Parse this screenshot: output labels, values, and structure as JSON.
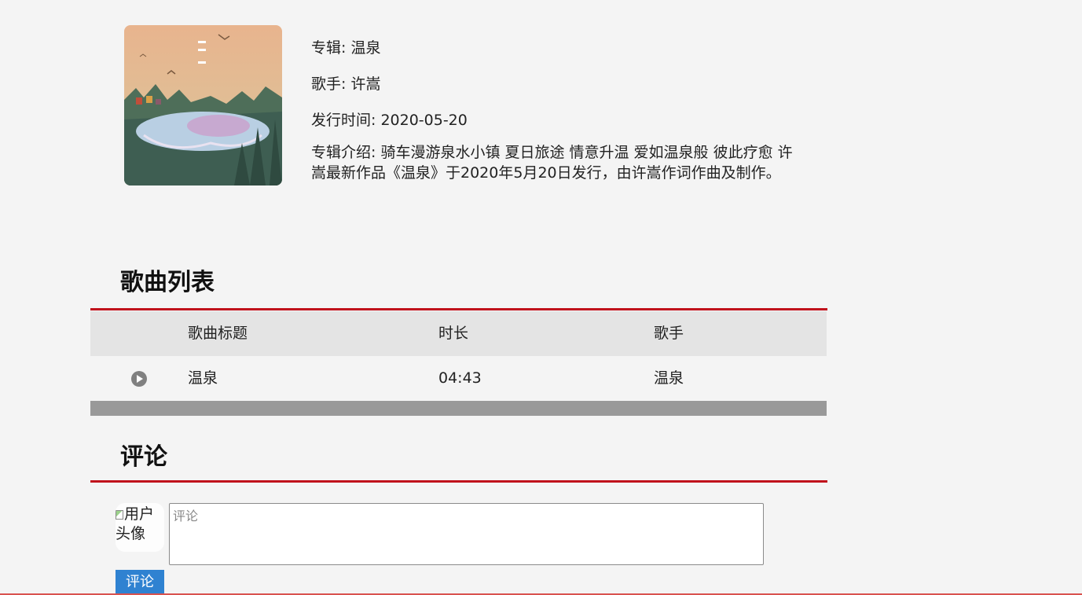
{
  "album": {
    "name": "专辑: 温泉",
    "artist": "歌手: 许嵩",
    "release": "发行时间: 2020-05-20",
    "intro": "专辑介绍: 骑车漫游泉水小镇 夏日旅途 情意升温 爱如温泉般 彼此疗愈 许嵩最新作品《温泉》于2020年5月20日发行，由许嵩作词作曲及制作。"
  },
  "songs": {
    "title": "歌曲列表",
    "headers": {
      "title": "歌曲标题",
      "duration": "时长",
      "artist": "歌手"
    },
    "rows": [
      {
        "title": "温泉",
        "duration": "04:43",
        "artist": "温泉"
      }
    ]
  },
  "comments": {
    "title": "评论",
    "avatar_alt": "用户头像",
    "placeholder": "评论",
    "submit_label": "评论"
  },
  "colors": {
    "accent_line": "#c0121c",
    "button": "#2f82d1",
    "header_bg": "#e4e4e4"
  }
}
